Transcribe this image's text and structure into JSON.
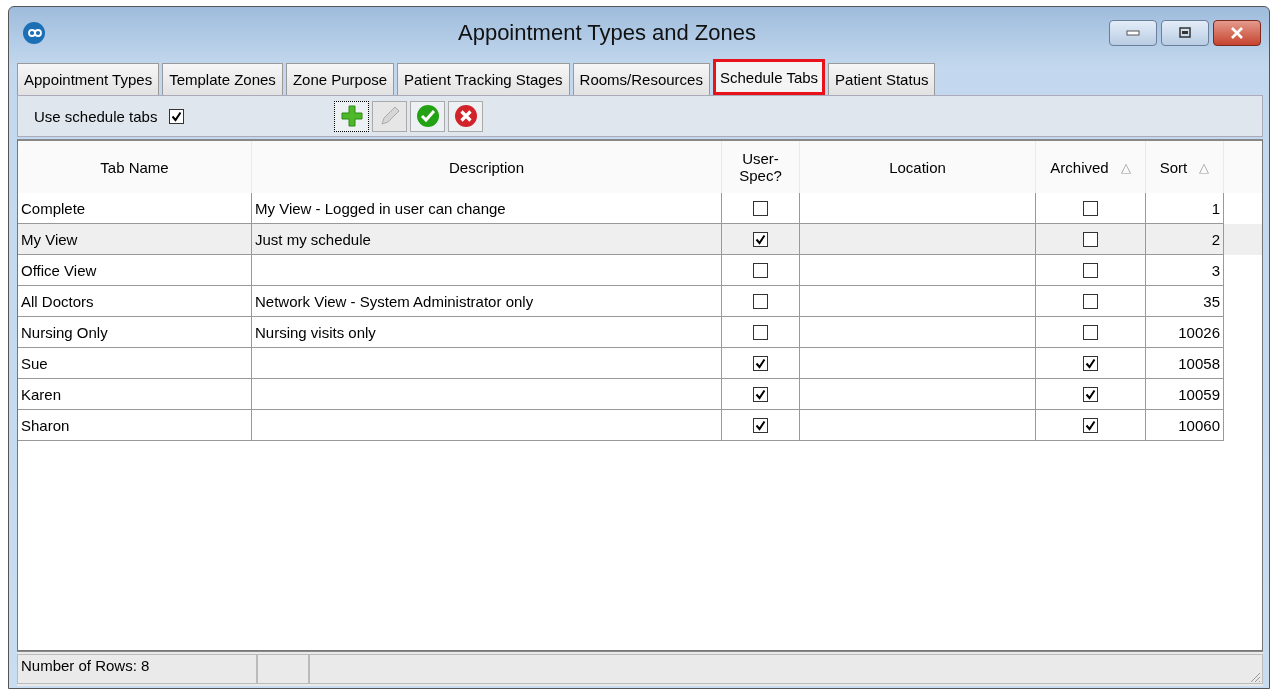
{
  "window": {
    "title": "Appointment Types and Zones"
  },
  "tabs": [
    {
      "label": "Appointment Types",
      "selected": false
    },
    {
      "label": "Template Zones",
      "selected": false
    },
    {
      "label": "Zone Purpose",
      "selected": false
    },
    {
      "label": "Patient Tracking Stages",
      "selected": false
    },
    {
      "label": "Rooms/Resources",
      "selected": false
    },
    {
      "label": "Schedule Tabs",
      "selected": true
    },
    {
      "label": "Patient Status",
      "selected": false
    }
  ],
  "toolbar": {
    "use_schedule_tabs": {
      "label": "Use schedule tabs",
      "checked": true
    },
    "buttons": [
      {
        "kind": "add",
        "disabled": false
      },
      {
        "kind": "edit",
        "disabled": true
      },
      {
        "kind": "save",
        "disabled": false
      },
      {
        "kind": "cancel",
        "disabled": false
      }
    ]
  },
  "table": {
    "columns": [
      {
        "label": "Tab Name"
      },
      {
        "label": "Description"
      },
      {
        "label": "User-Spec?"
      },
      {
        "label": "Location"
      },
      {
        "label": "Archived",
        "sort_mark": "△"
      },
      {
        "label": "Sort",
        "sort_mark": "△"
      }
    ],
    "rows": [
      {
        "tab_name": "Complete",
        "description": "My View - Logged in user can change",
        "user_spec": false,
        "archived": false,
        "sort": "1",
        "selected": false
      },
      {
        "tab_name": "My View",
        "description": "Just my schedule",
        "user_spec": true,
        "archived": false,
        "sort": "2",
        "selected": true
      },
      {
        "tab_name": "Office View",
        "user_spec": false,
        "archived": false,
        "sort": "3",
        "selected": false
      },
      {
        "tab_name": "All Doctors",
        "description": "Network View - System Administrator only",
        "user_spec": false,
        "archived": false,
        "sort": "35",
        "selected": false
      },
      {
        "tab_name": "Nursing Only",
        "description": "Nursing visits only",
        "user_spec": false,
        "archived": false,
        "sort": "10026",
        "selected": false
      },
      {
        "tab_name": "Sue",
        "user_spec": true,
        "archived": true,
        "sort": "10058",
        "selected": false
      },
      {
        "tab_name": "Karen",
        "user_spec": true,
        "archived": true,
        "sort": "10059",
        "selected": false
      },
      {
        "tab_name": "Sharon",
        "user_spec": true,
        "archived": true,
        "sort": "10060",
        "selected": false
      }
    ]
  },
  "status_bar": {
    "row_count": "Number of Rows: 8"
  }
}
